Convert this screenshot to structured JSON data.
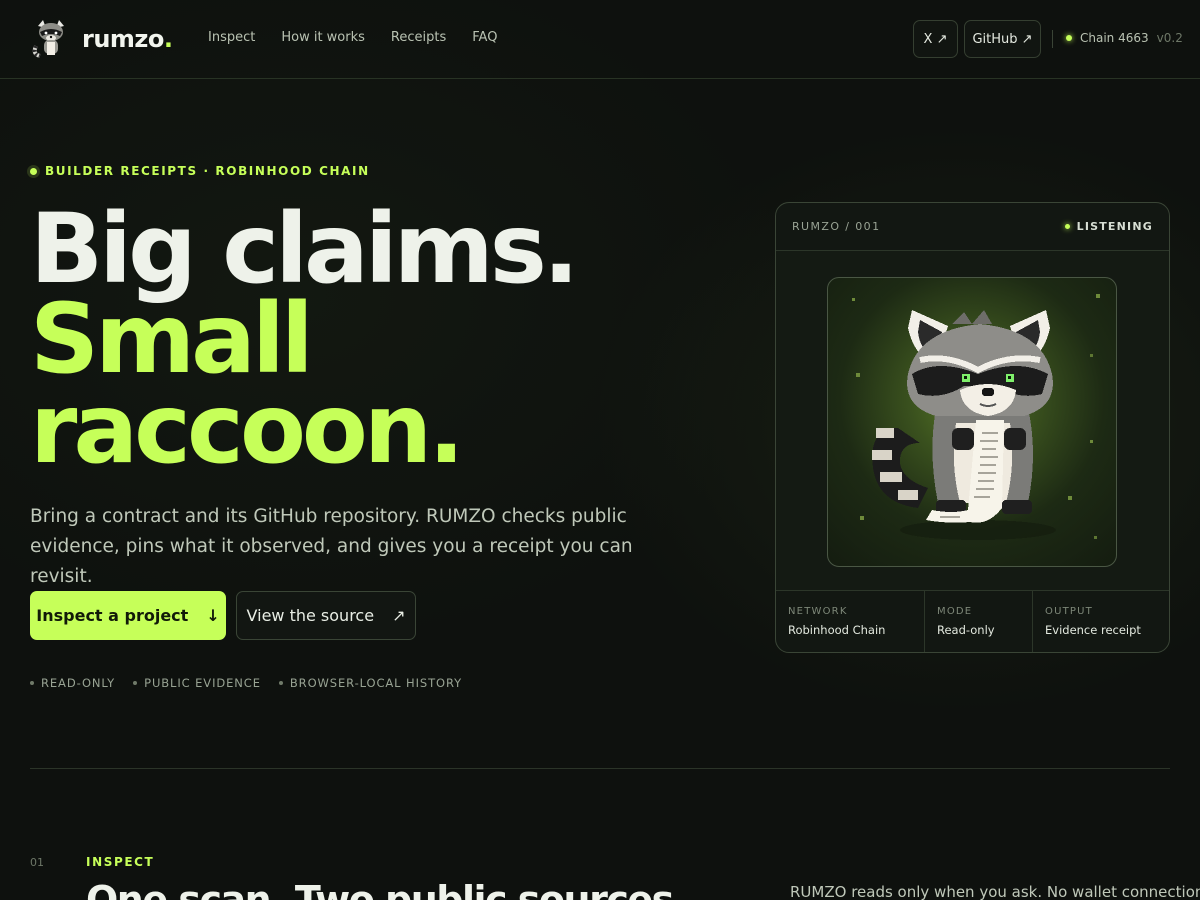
{
  "brand": {
    "name": "rumzo",
    "dot": "."
  },
  "nav": [
    {
      "label": "Inspect"
    },
    {
      "label": "How it works"
    },
    {
      "label": "Receipts"
    },
    {
      "label": "FAQ"
    }
  ],
  "header_links": {
    "x_label": "X ↗",
    "github_label": "GitHub ↗"
  },
  "chain": {
    "label": "Chain 4663",
    "version": "v0.2"
  },
  "hero": {
    "eyebrow": "BUILDER RECEIPTS · ROBINHOOD CHAIN",
    "headline_line1": "Big claims.",
    "headline_line2": "Small",
    "headline_line3": "raccoon.",
    "lede": "Bring a contract and its GitHub repository. RUMZO checks public evidence, pins what it observed, and gives you a receipt you can revisit.",
    "primary_cta": "Inspect a project",
    "primary_cta_icon": "↓",
    "secondary_cta": "View the source",
    "secondary_cta_icon": "↗",
    "badges": [
      "READ-ONLY",
      "PUBLIC EVIDENCE",
      "BROWSER-LOCAL HISTORY"
    ]
  },
  "card": {
    "id": "RUMZO / 001",
    "status": "LISTENING",
    "meta": [
      {
        "label": "NETWORK",
        "value": "Robinhood Chain"
      },
      {
        "label": "MODE",
        "value": "Read-only"
      },
      {
        "label": "OUTPUT",
        "value": "Evidence receipt"
      }
    ]
  },
  "section": {
    "number": "01",
    "eyebrow": "INSPECT",
    "title": "One scan. Two public sources.",
    "desc": "RUMZO reads only when you ask. No wallet connection"
  },
  "colors": {
    "accent": "#c6ff59",
    "background": "#0e110e"
  }
}
